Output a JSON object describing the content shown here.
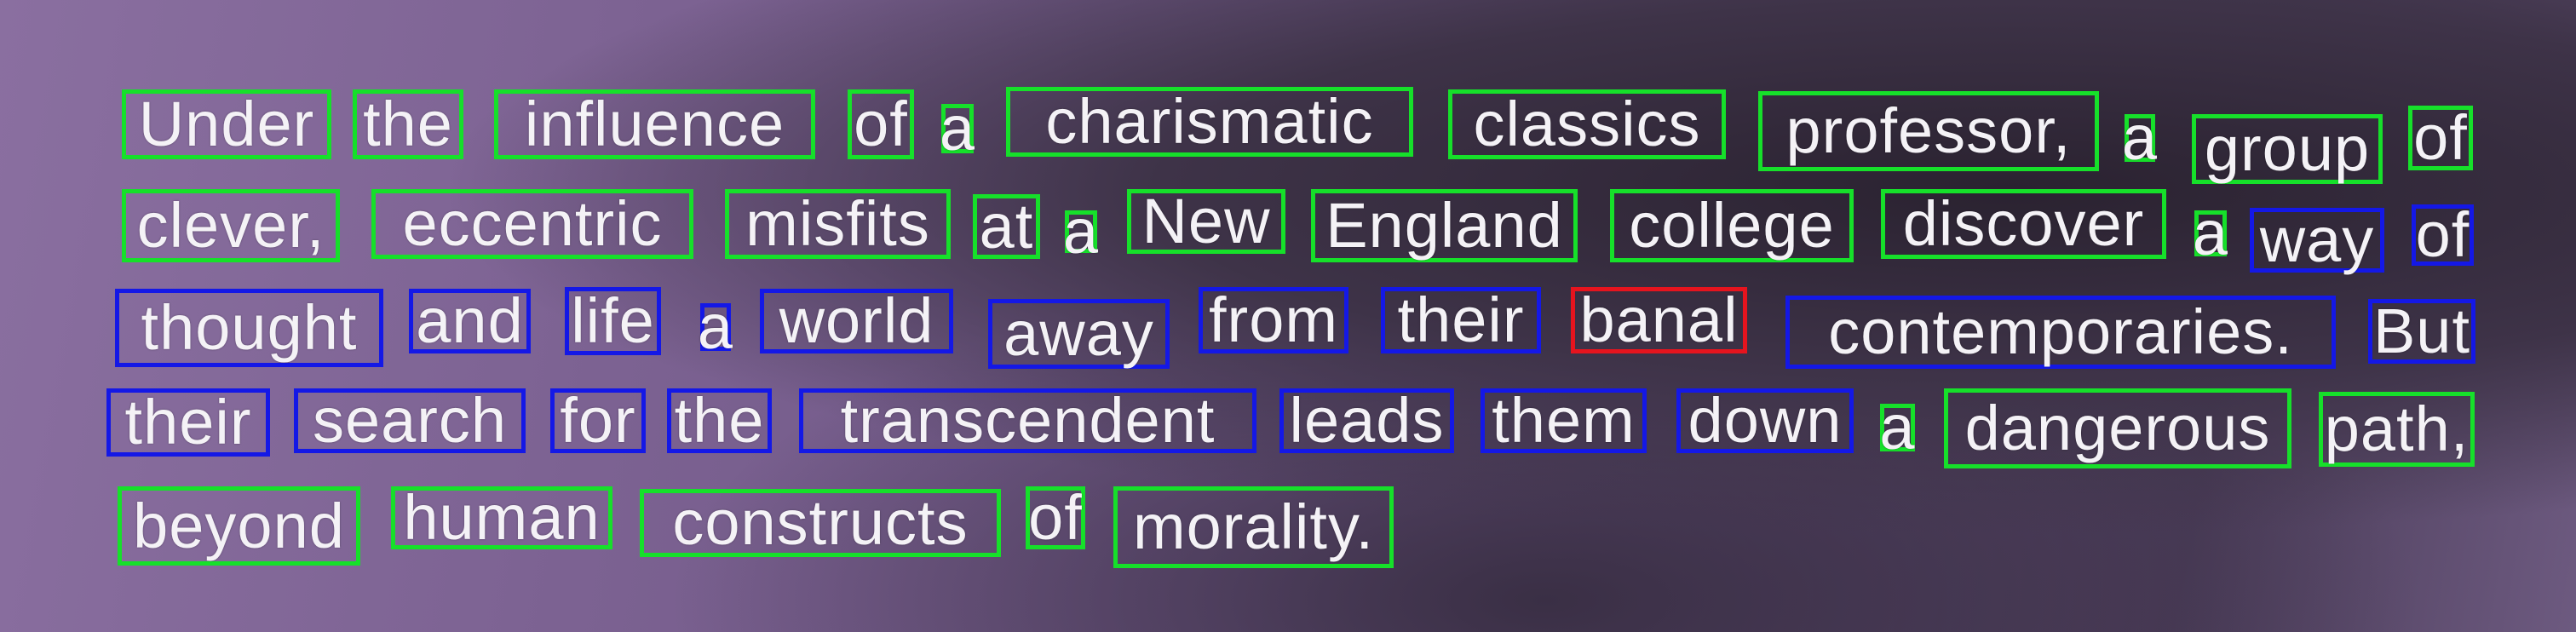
{
  "colors": {
    "green": "#16e02a",
    "blue": "#1418e6",
    "red": "#e6141e"
  },
  "words": [
    {
      "text": "Under",
      "status": "green"
    },
    {
      "text": "the",
      "status": "green"
    },
    {
      "text": "influence",
      "status": "green"
    },
    {
      "text": "of",
      "status": "green"
    },
    {
      "text": "a",
      "status": "green"
    },
    {
      "text": "charismatic",
      "status": "green"
    },
    {
      "text": "classics",
      "status": "green"
    },
    {
      "text": "professor,",
      "status": "green"
    },
    {
      "text": "a",
      "status": "green"
    },
    {
      "text": "group",
      "status": "green"
    },
    {
      "text": "of",
      "status": "green"
    },
    {
      "text": "clever,",
      "status": "green"
    },
    {
      "text": "eccentric",
      "status": "green"
    },
    {
      "text": "misfits",
      "status": "green"
    },
    {
      "text": "at",
      "status": "green"
    },
    {
      "text": "a",
      "status": "green"
    },
    {
      "text": "New",
      "status": "green"
    },
    {
      "text": "England",
      "status": "green"
    },
    {
      "text": "college",
      "status": "green"
    },
    {
      "text": "discover",
      "status": "green"
    },
    {
      "text": "a",
      "status": "green"
    },
    {
      "text": "way",
      "status": "blue"
    },
    {
      "text": "of",
      "status": "blue"
    },
    {
      "text": "thought",
      "status": "blue"
    },
    {
      "text": "and",
      "status": "blue"
    },
    {
      "text": "life",
      "status": "blue"
    },
    {
      "text": "a",
      "status": "blue"
    },
    {
      "text": "world",
      "status": "blue"
    },
    {
      "text": "away",
      "status": "blue"
    },
    {
      "text": "from",
      "status": "blue"
    },
    {
      "text": "their",
      "status": "blue"
    },
    {
      "text": "banal",
      "status": "red"
    },
    {
      "text": "contemporaries.",
      "status": "blue"
    },
    {
      "text": "But",
      "status": "blue"
    },
    {
      "text": "their",
      "status": "blue"
    },
    {
      "text": "search",
      "status": "blue"
    },
    {
      "text": "for",
      "status": "blue"
    },
    {
      "text": "the",
      "status": "blue"
    },
    {
      "text": "transcendent",
      "status": "blue"
    },
    {
      "text": "leads",
      "status": "blue"
    },
    {
      "text": "them",
      "status": "blue"
    },
    {
      "text": "down",
      "status": "blue"
    },
    {
      "text": "a",
      "status": "green"
    },
    {
      "text": "dangerous",
      "status": "green"
    },
    {
      "text": "path,",
      "status": "green"
    },
    {
      "text": "beyond",
      "status": "green"
    },
    {
      "text": "human",
      "status": "green"
    },
    {
      "text": "constructs",
      "status": "green"
    },
    {
      "text": "of",
      "status": "green"
    },
    {
      "text": "morality.",
      "status": "green"
    }
  ]
}
